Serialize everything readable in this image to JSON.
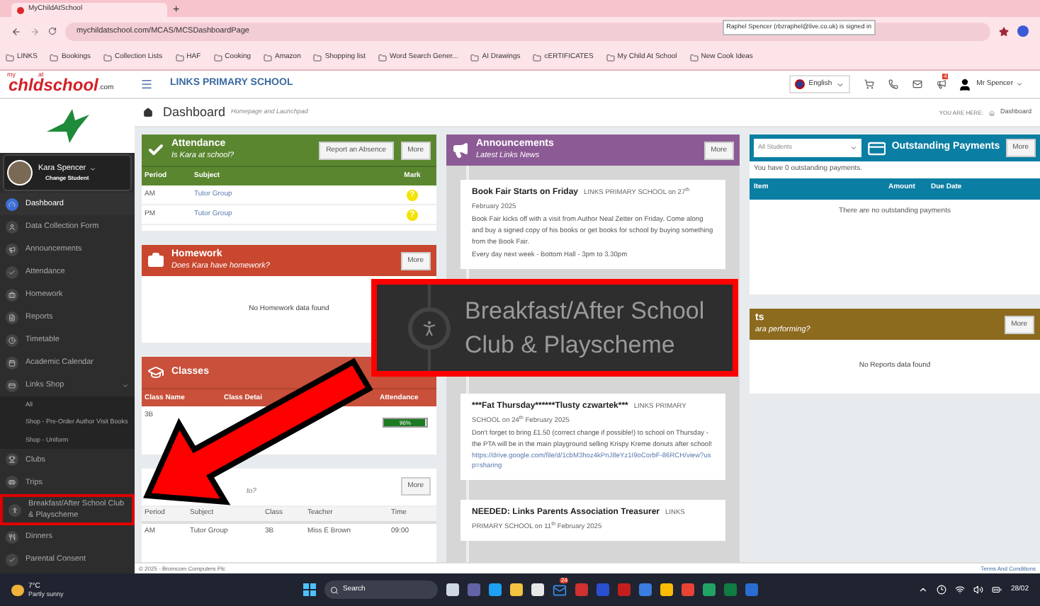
{
  "browser": {
    "tab_title": "MyChildAtSchool",
    "new_tab": "+",
    "url": "mychildatschool.com/MCAS/MCSDashboardPage",
    "profile_tooltip": "Raphel Spencer (rbzraphel@live.co.uk) is signed in",
    "bookmarks": [
      "LINKS",
      "Bookings",
      "Collection Lists",
      "HAF",
      "Cooking",
      "Amazon",
      "Shopping list",
      "Word Search Gener...",
      "AI Drawings",
      "cERTIFICATES",
      "My Child At School",
      "New Cook Ideas"
    ]
  },
  "header": {
    "logo": {
      "top": "my",
      "left": "ch",
      "right": "ld",
      "small": "at",
      "main": "school",
      "suffix": ".com"
    },
    "school_name": "LINKS PRIMARY SCHOOL",
    "language": "English",
    "notification_count": "4",
    "user": "Mr Spencer"
  },
  "sidebar": {
    "student": {
      "name": "Kara Spencer",
      "action": "Change Student"
    },
    "items": [
      {
        "label": "Dashboard",
        "selected": true,
        "highlighted": false
      },
      {
        "label": "Data Collection Form",
        "selected": false,
        "highlighted": false
      },
      {
        "label": "Announcements",
        "selected": false,
        "highlighted": false
      },
      {
        "label": "Attendance",
        "selected": false,
        "highlighted": false
      },
      {
        "label": "Homework",
        "selected": false,
        "highlighted": false
      },
      {
        "label": "Reports",
        "selected": false,
        "highlighted": false
      },
      {
        "label": "Timetable",
        "selected": false,
        "highlighted": false
      },
      {
        "label": "Academic Calendar",
        "selected": false,
        "highlighted": false
      },
      {
        "label": "Links Shop",
        "selected": false,
        "highlighted": false,
        "expanded": true,
        "children": [
          {
            "label": "All"
          },
          {
            "label": "Shop - Pre-Order Author Visit Books"
          },
          {
            "label": "Shop - Uniform"
          }
        ]
      },
      {
        "label": "Clubs",
        "selected": false,
        "highlighted": false
      },
      {
        "label": "Trips",
        "selected": false,
        "highlighted": false
      },
      {
        "label": "Breakfast/After School Club & Playscheme",
        "selected": false,
        "highlighted": true
      },
      {
        "label": "Dinners",
        "selected": false,
        "highlighted": false
      },
      {
        "label": "Parental Consent",
        "selected": false,
        "highlighted": false
      }
    ]
  },
  "breadcrumb": {
    "title": "Dashboard",
    "subtitle": "Homepage and Launchpad",
    "you_are_here": "YOU ARE HERE:",
    "current": "Dashboard"
  },
  "attendance": {
    "title": "Attendance",
    "subtitle": "Is Kara at school?",
    "buttons": [
      "Report an Absence",
      "More"
    ],
    "columns": [
      "Period",
      "Subject",
      "Mark"
    ],
    "rows": [
      {
        "period": "AM",
        "subject": "Tutor Group",
        "mark": "?"
      },
      {
        "period": "PM",
        "subject": "Tutor Group",
        "mark": "?"
      }
    ]
  },
  "homework": {
    "title": "Homework",
    "subtitle": "Does Kara have homework?",
    "button": "More",
    "empty": "No Homework data found"
  },
  "classes": {
    "title": "Classes",
    "columns": [
      "Class Name",
      "Class Detai",
      "Attendance"
    ],
    "rows": [
      {
        "name": "3B",
        "attendance": "96%",
        "level": 0.96
      }
    ]
  },
  "timetable": {
    "subtitle": "to?",
    "button": "More",
    "columns": [
      "Period",
      "Subject",
      "Class",
      "Teacher",
      "Time"
    ],
    "rows": [
      [
        "AM",
        "Tutor Group",
        "3B",
        "Miss E Brown",
        "09:00"
      ]
    ]
  },
  "announcements": {
    "title": "Announcements",
    "subtitle": "Latest Links News",
    "button": "More",
    "items": [
      {
        "title": "Book Fair Starts on Friday",
        "meta": "LINKS PRIMARY SCHOOL on 27$^{th}$ February 2025",
        "body": [
          "Book Fair kicks off with a visit from Author Neal Zetter on Friday. Come along and buy a signed copy of his books or get books for school by buying something from the Book Fair.",
          "Every day next week - Bottom Hall - 3pm to 3.30pm"
        ]
      },
      {
        "title": "***Fat Thursday******Tlusty czwartek***",
        "meta": "LINKS PRIMARY SCHOOL on 24$^{th}$ February 2025",
        "body": [
          "Don't forget to bring £1.50 (correct change if possible!) to school on Thursday - the PTA will be in the main playground selling Krispy Kreme donuts after school!"
        ],
        "link": "https://drive.google.com/file/d/1cbM3hoz4kPnJ8eYz1I9oCorbF-86RCH/view?usp=sharing"
      },
      {
        "title": "NEEDED: Links Parents Association Treasurer",
        "meta": "LINKS PRIMARY SCHOOL on 11$^{th}$ February 2025"
      }
    ]
  },
  "payments": {
    "filter": "All Students",
    "title": "Outstanding Payments",
    "button": "More",
    "summary": "You have 0 outstanding payments.",
    "columns": [
      "Item",
      "Amount",
      "Due Date"
    ],
    "empty": "There are no outstanding payments"
  },
  "reports": {
    "title": "ts",
    "subtitle": "ara performing?",
    "button": "More",
    "empty": "No Reports data found"
  },
  "footer": {
    "copyright": "© 2025 - Bromcom Computers Plc",
    "terms": "Terms And Conditions"
  },
  "callout": {
    "text": "Breakfast/After School Club & Playscheme"
  },
  "taskbar": {
    "temperature": "7°C",
    "weather": "Partly sunny",
    "search": "Search",
    "mail_count": "24",
    "date": "28/02"
  }
}
